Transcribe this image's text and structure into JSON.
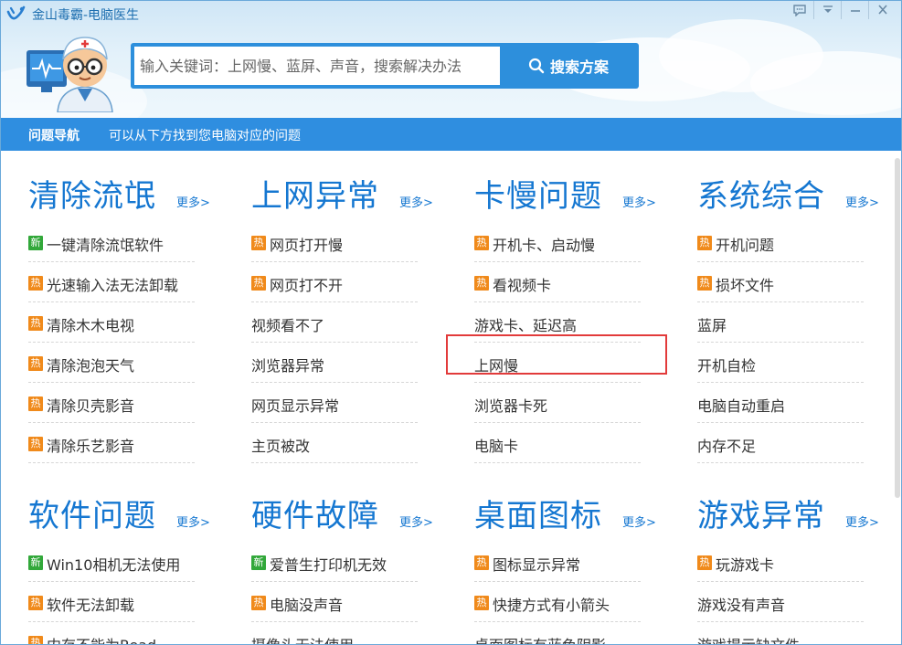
{
  "app": {
    "title": "金山毒霸-电脑医生"
  },
  "search": {
    "placeholder": "输入关键词：上网慢、蓝屏、声音，搜索解决办法",
    "button_label": "搜索方案"
  },
  "nav": {
    "title": "问题导航",
    "description": "可以从下方找到您电脑对应的问题"
  },
  "colors": {
    "accent": "#2f8ee0",
    "title_blue": "#1577d1",
    "hot_badge": "#f08a1b",
    "new_badge": "#32a83a",
    "highlight": "#e23b3b"
  },
  "sections": [
    {
      "title": "清除流氓",
      "more": "更多>",
      "items": [
        {
          "text": "一键清除流氓软件",
          "badge": "新"
        },
        {
          "text": "光速输入法无法卸载",
          "badge": "热"
        },
        {
          "text": "清除木木电视",
          "badge": "热"
        },
        {
          "text": "清除泡泡天气",
          "badge": "热"
        },
        {
          "text": "清除贝壳影音",
          "badge": "热"
        },
        {
          "text": "清除乐艺影音",
          "badge": "热"
        }
      ]
    },
    {
      "title": "上网异常",
      "more": "更多>",
      "items": [
        {
          "text": "网页打开慢",
          "badge": "热"
        },
        {
          "text": "网页打不开",
          "badge": "热"
        },
        {
          "text": "视频看不了",
          "badge": ""
        },
        {
          "text": "浏览器异常",
          "badge": ""
        },
        {
          "text": "网页显示异常",
          "badge": ""
        },
        {
          "text": "主页被改",
          "badge": ""
        }
      ]
    },
    {
      "title": "卡慢问题",
      "more": "更多>",
      "items": [
        {
          "text": "开机卡、启动慢",
          "badge": "热"
        },
        {
          "text": "看视频卡",
          "badge": "热"
        },
        {
          "text": "游戏卡、延迟高",
          "badge": ""
        },
        {
          "text": "上网慢",
          "badge": ""
        },
        {
          "text": "浏览器卡死",
          "badge": ""
        },
        {
          "text": "电脑卡",
          "badge": ""
        }
      ]
    },
    {
      "title": "系统综合",
      "more": "更多>",
      "items": [
        {
          "text": "开机问题",
          "badge": "热"
        },
        {
          "text": "损坏文件",
          "badge": "热"
        },
        {
          "text": "蓝屏",
          "badge": ""
        },
        {
          "text": "开机自检",
          "badge": ""
        },
        {
          "text": "电脑自动重启",
          "badge": ""
        },
        {
          "text": "内存不足",
          "badge": ""
        }
      ]
    },
    {
      "title": "软件问题",
      "more": "更多>",
      "items": [
        {
          "text": "Win10相机无法使用",
          "badge": "新"
        },
        {
          "text": "软件无法卸载",
          "badge": "热"
        },
        {
          "text": "内存不能为Read",
          "badge": "热"
        }
      ]
    },
    {
      "title": "硬件故障",
      "more": "更多>",
      "items": [
        {
          "text": "爱普生打印机无效",
          "badge": "新"
        },
        {
          "text": "电脑没声音",
          "badge": "热"
        },
        {
          "text": "摄像头无法使用",
          "badge": ""
        }
      ]
    },
    {
      "title": "桌面图标",
      "more": "更多>",
      "items": [
        {
          "text": "图标显示异常",
          "badge": "热"
        },
        {
          "text": "快捷方式有小箭头",
          "badge": "热"
        },
        {
          "text": "桌面图标有蓝色阴影",
          "badge": ""
        }
      ]
    },
    {
      "title": "游戏异常",
      "more": "更多>",
      "items": [
        {
          "text": "玩游戏卡",
          "badge": "热"
        },
        {
          "text": "游戏没有声音",
          "badge": ""
        },
        {
          "text": "游戏提示缺文件",
          "badge": ""
        }
      ]
    }
  ]
}
